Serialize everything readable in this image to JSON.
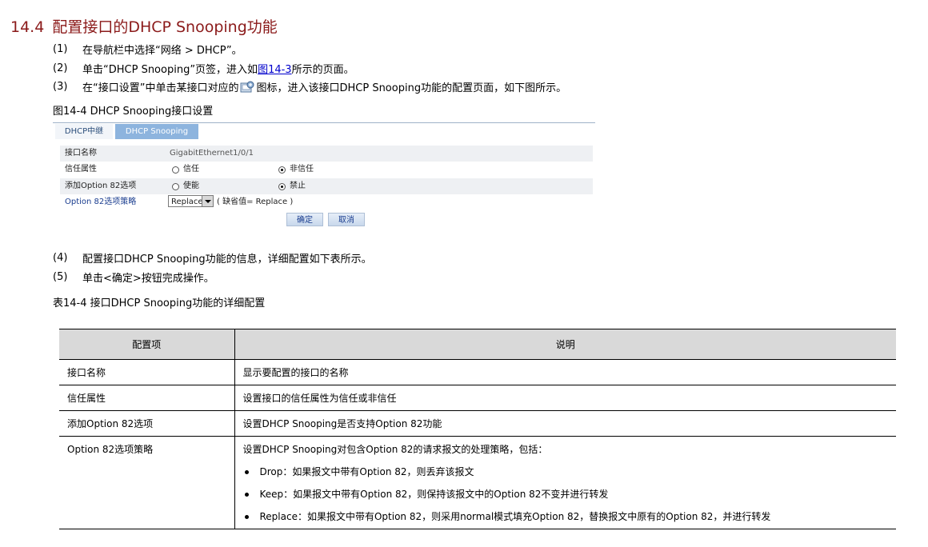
{
  "heading": {
    "number": "14.4",
    "title": "配置接口的DHCP Snooping功能"
  },
  "steps": [
    {
      "num": "(1)",
      "text": "在导航栏中选择“网络 > DHCP”。"
    },
    {
      "num": "(2)",
      "pre": "单击“DHCP Snooping”页签，进入如",
      "link": "图14-3",
      "post": "所示的页面。"
    },
    {
      "num": "(3)",
      "pre": "在“接口设置”中单击某接口对应的",
      "post": "图标，进入该接口DHCP Snooping功能的配置页面，如下图所示。",
      "icon": "config-icon"
    },
    {
      "num": "(4)",
      "text": "配置接口DHCP Snooping功能的信息，详细配置如下表所示。"
    },
    {
      "num": "(5)",
      "text": "单击<确定>按钮完成操作。"
    }
  ],
  "figure": {
    "caption": "图14-4 DHCP Snooping接口设置",
    "tabs": [
      "DHCP中继",
      "DHCP Snooping"
    ],
    "rows": {
      "iface_label": "接口名称",
      "iface_value": "GigabitEthernet1/0/1",
      "trust_label": "信任属性",
      "trust_opt1": "信任",
      "trust_opt2": "非信任",
      "opt82_label": "添加Option 82选项",
      "opt82_opt1": "使能",
      "opt82_opt2": "禁止",
      "policy_label": "Option 82选项策略",
      "policy_value": "Replace",
      "policy_hint": "( 缺省值= Replace )"
    },
    "buttons": {
      "ok": "确定",
      "cancel": "取消"
    }
  },
  "table": {
    "caption": "表14-4 接口DHCP Snooping功能的详细配置",
    "headers": [
      "配置项",
      "说明"
    ],
    "rows": [
      {
        "item": "接口名称",
        "desc": "显示要配置的接口的名称"
      },
      {
        "item": "信任属性",
        "desc": "设置接口的信任属性为信任或非信任"
      },
      {
        "item": "添加Option 82选项",
        "desc": "设置DHCP Snooping是否支持Option 82功能"
      },
      {
        "item": "Option 82选项策略",
        "desc": "设置DHCP Snooping对包含Option 82的请求报文的处理策略，包括：",
        "bullets": [
          "Drop：如果报文中带有Option 82，则丢弃该报文",
          "Keep：如果报文中带有Option 82，则保持该报文中的Option 82不变并进行转发",
          "Replace：如果报文中带有Option 82，则采用normal模式填充Option 82，替换报文中原有的Option 82，并进行转发"
        ]
      }
    ]
  }
}
